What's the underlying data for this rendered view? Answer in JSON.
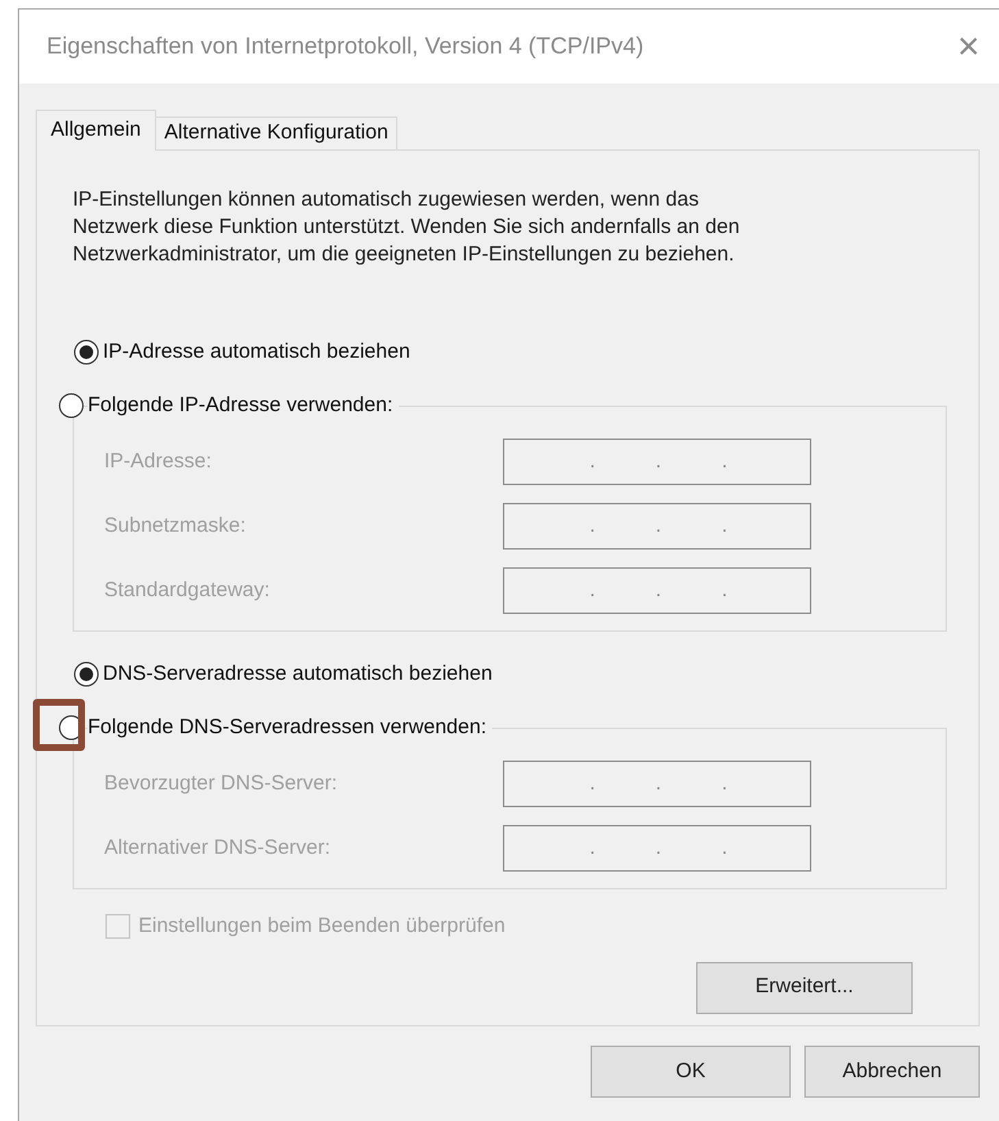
{
  "window": {
    "title": "Eigenschaften von Internetprotokoll, Version 4 (TCP/IPv4)",
    "close": "×"
  },
  "tabs": [
    {
      "label": "Allgemein",
      "selected": true
    },
    {
      "label": "Alternative Konfiguration",
      "selected": false
    }
  ],
  "description": "IP-Einstellungen können automatisch zugewiesen werden, wenn das Netzwerk diese Funktion unterstützt. Wenden Sie sich andernfalls an den Netzwerkadministrator, um die geeigneten IP-Einstellungen zu beziehen.",
  "sections": [
    {
      "auto_option": {
        "label": "IP-Adresse automatisch beziehen",
        "selected": true
      },
      "manual_option": {
        "label": "Folgende IP-Adresse verwenden:",
        "selected": false,
        "highlighted": false
      },
      "fields": [
        {
          "label": "IP-Adresse:",
          "disabled": true,
          "separators": [
            ".",
            ".",
            "."
          ]
        },
        {
          "label": "Subnetzmaske:",
          "disabled": true,
          "separators": [
            ".",
            ".",
            "."
          ]
        },
        {
          "label": "Standardgateway:",
          "disabled": true,
          "separators": [
            ".",
            ".",
            "."
          ]
        }
      ]
    },
    {
      "auto_option": {
        "label": "DNS-Serveradresse automatisch beziehen",
        "selected": true
      },
      "manual_option": {
        "label": "Folgende DNS-Serveradressen verwenden:",
        "selected": false,
        "highlighted": true
      },
      "fields": [
        {
          "label": "Bevorzugter DNS-Server:",
          "disabled": true,
          "separators": [
            ".",
            ".",
            "."
          ]
        },
        {
          "label": "Alternativer DNS-Server:",
          "disabled": true,
          "separators": [
            ".",
            ".",
            "."
          ]
        }
      ]
    }
  ],
  "validate_checkbox": {
    "label": "Einstellungen beim Beenden überprüfen",
    "checked": false,
    "disabled": true
  },
  "advanced_button": "Erweitert...",
  "buttons": [
    "OK",
    "Abbrechen"
  ]
}
